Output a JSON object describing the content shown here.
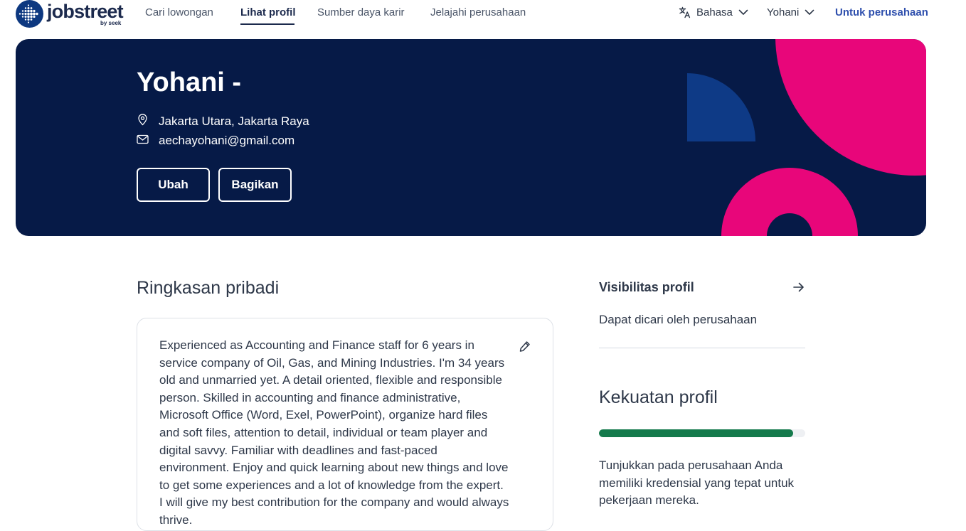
{
  "nav": {
    "logo_text": "jobstreet",
    "logo_sub": "by seek",
    "links": [
      "Cari lowongan",
      "Lihat profil",
      "Sumber daya karir",
      "Jelajahi perusahaan"
    ],
    "active_link": "Lihat profil",
    "language_label": "Bahasa",
    "user_label": "Yohani",
    "employer_link": "Untuk perusahaan"
  },
  "hero": {
    "name": "Yohani -",
    "location": "Jakarta Utara, Jakarta Raya",
    "email": "aechayohani@gmail.com",
    "edit_button": "Ubah",
    "share_button": "Bagikan"
  },
  "summary": {
    "title": "Ringkasan pribadi",
    "text": "Experienced as Accounting and Finance staff for 6 years in service company of Oil, Gas, and Mining Industries. I'm 34 years old and unmarried yet. A detail oriented, flexible and responsible person. Skilled in accounting and finance administrative, Microsoft Office (Word, Exel, PowerPoint), organize hard files and soft files, attention to detail, individual or team player and digital savvy. Familiar with deadlines and fast-paced environment. Enjoy and quick learning about new things and love to get some experiences and a lot of knowledge from the expert. I will give my best contribution for the company and would always thrive."
  },
  "visibility": {
    "title": "Visibilitas profil",
    "description": "Dapat dicari oleh perusahaan"
  },
  "strength": {
    "title": "Kekuatan profil",
    "progress_fraction": 0.94,
    "description": "Tunjukkan pada perusahaan Anda memiliki kredensial yang tepat untuk pekerjaan mereka."
  },
  "colors": {
    "hero_background": "#061a47",
    "accent_pink": "#e8067a",
    "accent_blue": "#0e3a86",
    "progress_green": "#157a4c",
    "employer_link": "#2e4fad"
  },
  "icons": [
    "logo-dots-icon",
    "translate-icon",
    "chevron-down-icon",
    "location-pin-icon",
    "mail-icon",
    "pencil-icon",
    "arrow-right-icon"
  ]
}
